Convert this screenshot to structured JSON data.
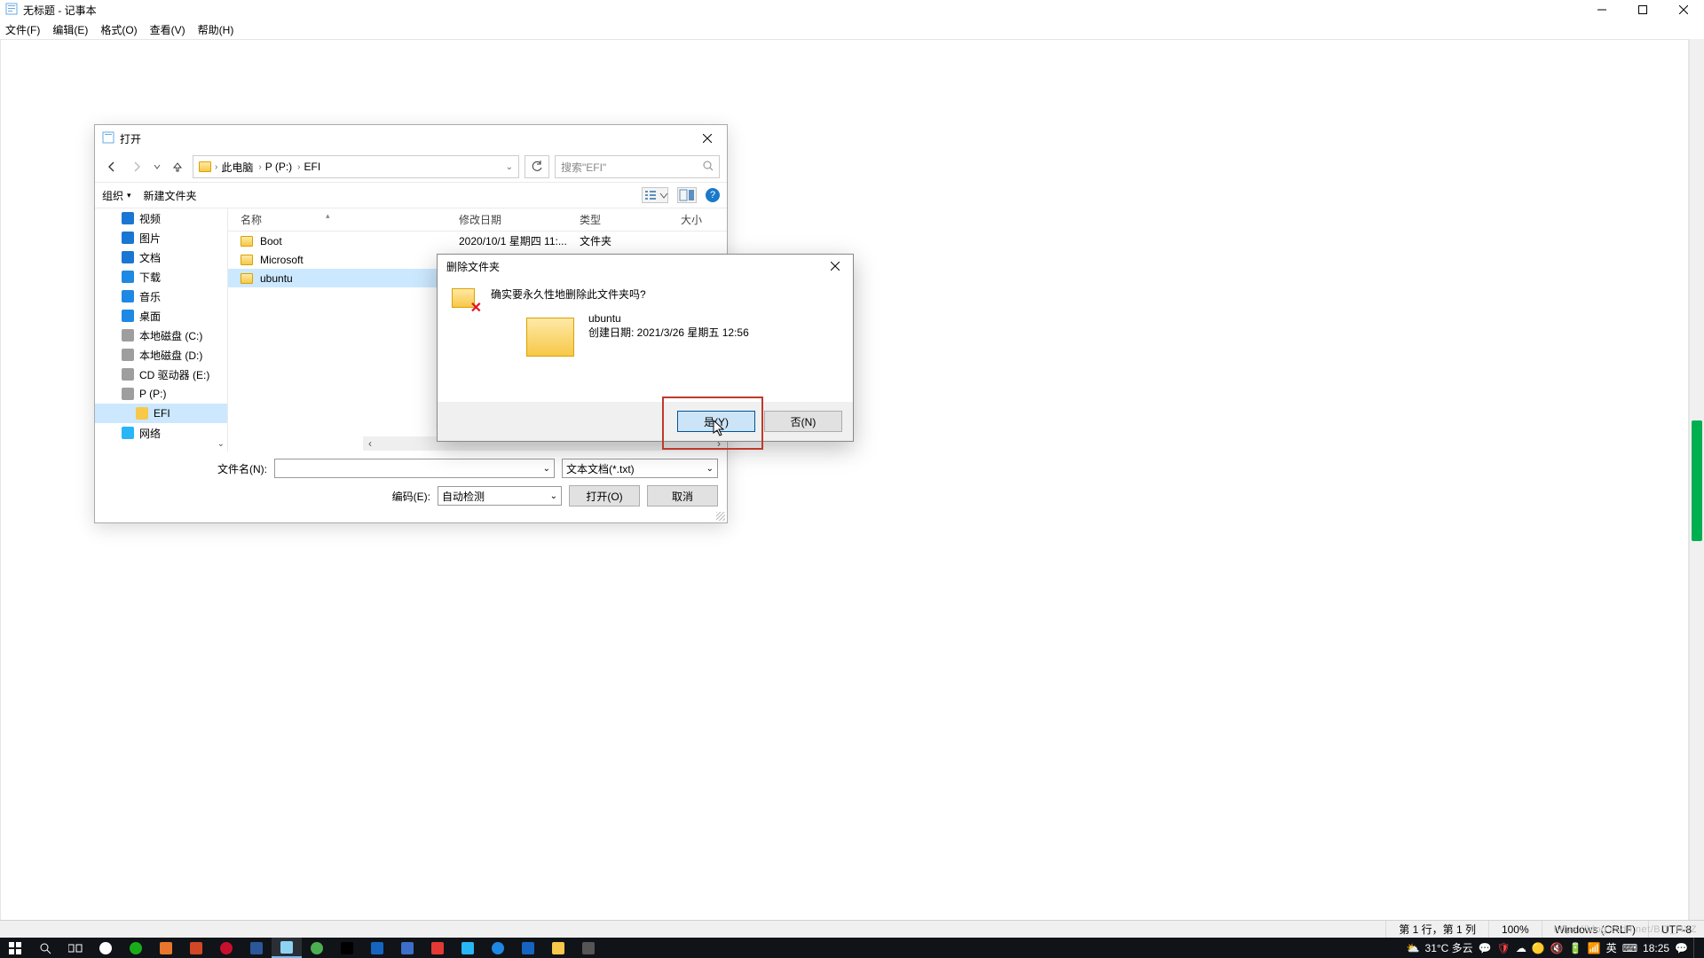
{
  "notepad": {
    "title": "无标题 - 记事本",
    "menu": {
      "file": "文件(F)",
      "edit": "编辑(E)",
      "format": "格式(O)",
      "view": "查看(V)",
      "help": "帮助(H)"
    },
    "status": {
      "pos": "第 1 行，第 1 列",
      "zoom": "100%",
      "eol": "Windows (CRLF)",
      "enc": "UTF-8"
    }
  },
  "open_dialog": {
    "title": "打开",
    "breadcrumb": [
      "此电脑",
      "P (P:)",
      "EFI"
    ],
    "search_placeholder": "搜索\"EFI\"",
    "toolbar": {
      "organize": "组织",
      "new_folder": "新建文件夹"
    },
    "columns": {
      "name": "名称",
      "date": "修改日期",
      "type": "类型",
      "size": "大小"
    },
    "tree": [
      {
        "label": "视频",
        "icon": "#1976d2"
      },
      {
        "label": "图片",
        "icon": "#1976d2"
      },
      {
        "label": "文档",
        "icon": "#1976d2"
      },
      {
        "label": "下载",
        "icon": "#1e88e5"
      },
      {
        "label": "音乐",
        "icon": "#1e88e5"
      },
      {
        "label": "桌面",
        "icon": "#1e88e5"
      },
      {
        "label": "本地磁盘 (C:)",
        "icon": "#9e9e9e"
      },
      {
        "label": "本地磁盘 (D:)",
        "icon": "#9e9e9e"
      },
      {
        "label": "CD 驱动器 (E:)",
        "icon": "#9e9e9e"
      },
      {
        "label": "P (P:)",
        "icon": "#9e9e9e"
      },
      {
        "label": "EFI",
        "icon": "#f7c849",
        "sub": true,
        "selected": true
      },
      {
        "label": "网络",
        "icon": "#29b6f6"
      }
    ],
    "rows": [
      {
        "name": "Boot",
        "date": "2020/10/1 星期四 11:...",
        "type": "文件夹"
      },
      {
        "name": "Microsoft",
        "date": "",
        "type": ""
      },
      {
        "name": "ubuntu",
        "date": "",
        "type": "",
        "selected": true
      }
    ],
    "filename_label": "文件名(N):",
    "filetype_value": "文本文档(*.txt)",
    "encoding_label": "编码(E):",
    "encoding_value": "自动检测",
    "open_btn": "打开(O)",
    "cancel_btn": "取消"
  },
  "confirm": {
    "title": "删除文件夹",
    "question": "确实要永久性地删除此文件夹吗?",
    "item_name": "ubuntu",
    "created_line": "创建日期: 2021/3/26 星期五 12:56",
    "yes": "是(Y)",
    "no": "否(N)"
  },
  "taskbar": {
    "weather": "31°C 多云",
    "time": "18:25",
    "watermark_right": "https://blog.csdn.net/BIT_HXZ"
  }
}
